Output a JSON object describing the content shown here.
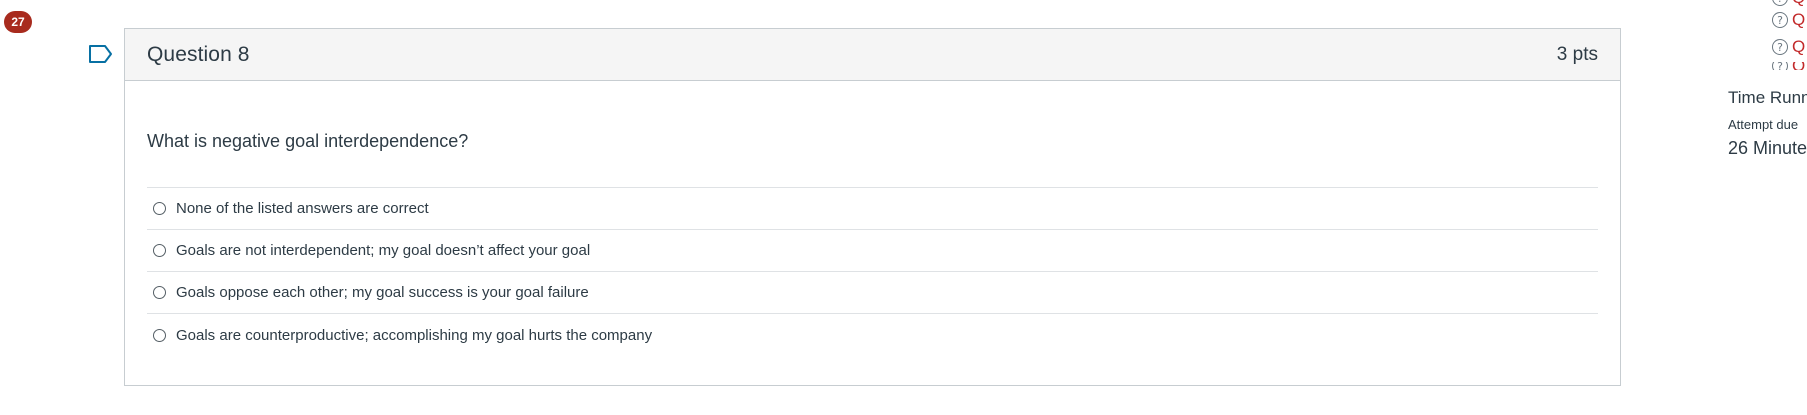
{
  "notification": {
    "count": "27"
  },
  "question": {
    "title": "Question 8",
    "points": "3 pts",
    "text": "What is negative goal interdependence?",
    "answers": [
      {
        "label": "None of the listed answers are correct"
      },
      {
        "label": "Goals are not interdependent; my goal doesn’t affect your goal"
      },
      {
        "label": "Goals oppose each other; my goal success is your goal failure"
      },
      {
        "label": "Goals are counterproductive; accomplishing my goal hurts the company"
      }
    ]
  },
  "sidebar": {
    "question_links": [
      {
        "icon": "help-icon",
        "label": "Q"
      },
      {
        "icon": "help-icon",
        "label": "Q"
      },
      {
        "icon": "help-icon",
        "label": "Q"
      },
      {
        "icon": "help-icon",
        "label": "Q"
      }
    ],
    "timer": {
      "title": "Time Runn",
      "due_label": "Attempt due",
      "remaining": "26 Minute"
    }
  },
  "colors": {
    "badge": "#a82b1e",
    "flag": "#0770a3",
    "link": "#c2292a",
    "header_bg": "#f5f5f5",
    "border": "#c7cdd1"
  }
}
